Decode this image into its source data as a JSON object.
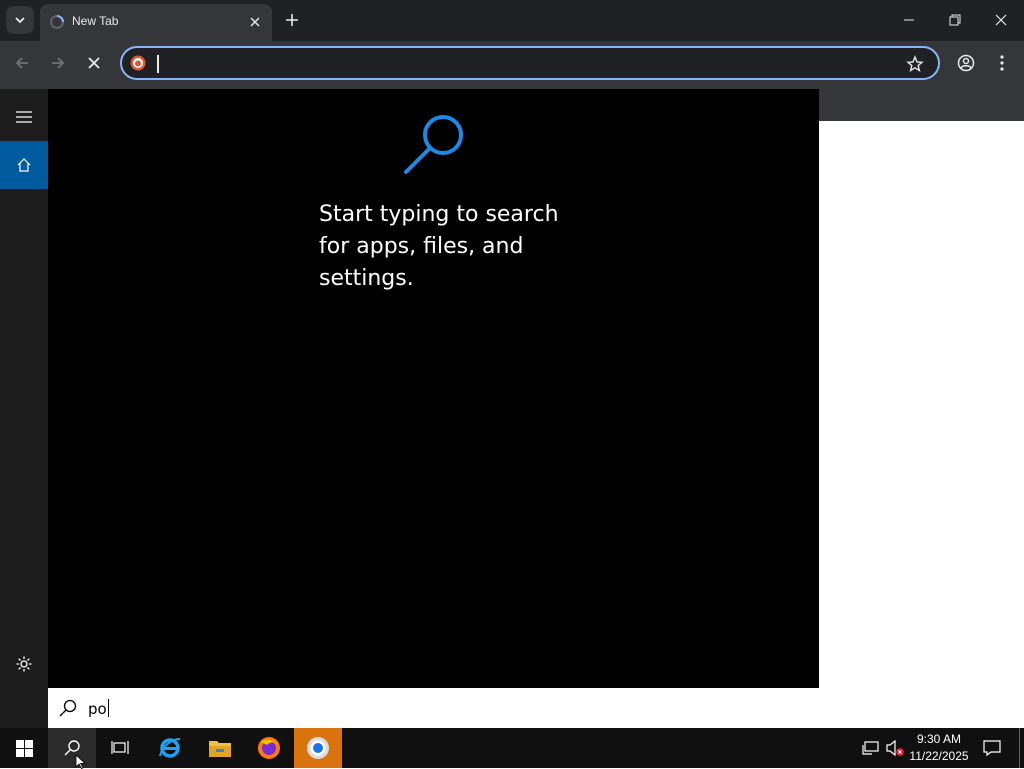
{
  "browser": {
    "tab": {
      "title": "New Tab",
      "state": "loading"
    },
    "address_bar": {
      "value": "",
      "placeholder": ""
    },
    "colors": {
      "chrome_dark": "#202124",
      "toolbar": "#35363a",
      "focus_ring": "#8ab4f8"
    }
  },
  "search_flyout": {
    "hint": "Start typing to search for apps, files, and settings.",
    "query": "po",
    "accent": "#005a9e",
    "icon_color": "#1a8ae8"
  },
  "taskbar": {
    "apps": [
      {
        "name": "start-icon"
      },
      {
        "name": "search-icon"
      },
      {
        "name": "task-view-icon"
      },
      {
        "name": "internet-explorer-icon"
      },
      {
        "name": "file-explorer-icon"
      },
      {
        "name": "firefox-icon"
      },
      {
        "name": "chrome-icon"
      }
    ],
    "clock": {
      "time": "9:30 AM",
      "date": "11/22/2025"
    }
  }
}
